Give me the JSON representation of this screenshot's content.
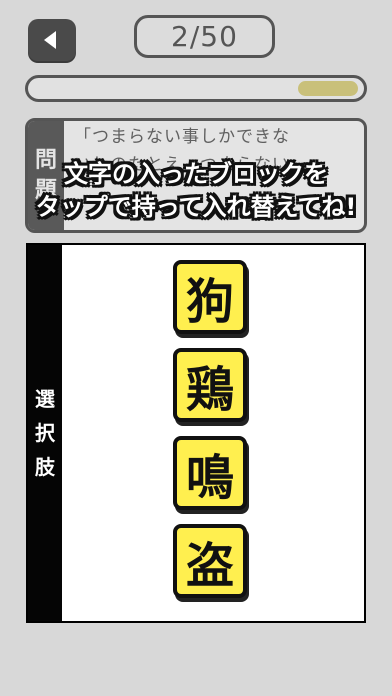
{
  "header": {
    "counter": "2/50",
    "progress_fraction": 0.18
  },
  "question": {
    "tab_chars": [
      "問",
      "題"
    ],
    "lines": [
      "「つまらない事しかできな",
      "いしのたとえ、つまらない"
    ]
  },
  "instruction": {
    "lines": [
      "文字の入ったブロックを",
      "タップで持って入れ替えてね!"
    ]
  },
  "choices": {
    "tab_chars": [
      "選",
      "択",
      "肢"
    ],
    "tiles": [
      "狗",
      "鶏",
      "鳴",
      "盗"
    ]
  },
  "colors": {
    "tile": "#ffef4f",
    "progress_fill": "#c9c07a",
    "dark": "#4a4a4a"
  }
}
